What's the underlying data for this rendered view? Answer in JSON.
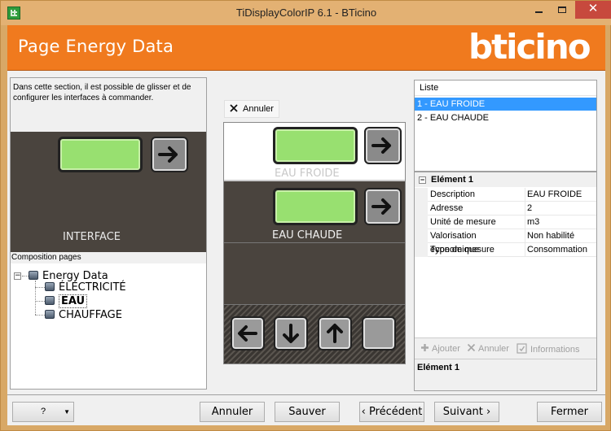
{
  "window": {
    "title": "TiDisplayColorIP 6.1 - BTicino",
    "minimize": "—",
    "close": "✕"
  },
  "header": {
    "page_title": "Page Energy Data",
    "brand": "bticino"
  },
  "left": {
    "help_text": "Dans cette section, il est possible de glisser et de configurer les interfaces à commander.",
    "interface_label": "INTERFACE",
    "composition_label": "Composition pages",
    "tree": {
      "root": "Energy Data",
      "expander": "−",
      "children": [
        "ÉLECTRICITÉ",
        "EAU",
        "CHAUFFAGE"
      ],
      "selected": "EAU"
    }
  },
  "center": {
    "annuler_label": "Annuler",
    "rows": [
      {
        "label": "EAU FROIDE"
      },
      {
        "label": "EAU CHAUDE"
      }
    ]
  },
  "right": {
    "list_header": "Liste",
    "list_items": [
      "1 - EAU FROIDE",
      "2 - EAU CHAUDE"
    ],
    "selected_index": 0,
    "props_heading": "Elément 1",
    "props_collapse": "−",
    "properties": [
      {
        "name": "Description",
        "value": "EAU FROIDE"
      },
      {
        "name": "Adresse",
        "value": "2"
      },
      {
        "name": "Unité de mesure",
        "value": "m3"
      },
      {
        "name": "Valorisation économique",
        "value": "Non habilité"
      },
      {
        "name": "Type de mesure",
        "value": "Consommation"
      }
    ],
    "toolbar": {
      "add": "Ajouter",
      "cancel": "Annuler",
      "info": "Informations"
    },
    "description": "Elément 1"
  },
  "footer": {
    "help": "?",
    "annuler": "Annuler",
    "sauver": "Sauver",
    "precedent": "‹ Précédent",
    "suivant": "Suivant ›",
    "fermer": "Fermer"
  },
  "colors": {
    "header": "#f07a1e",
    "selection": "#3399ff",
    "preview_bg": "#4a443e",
    "screen": "#98e070"
  }
}
